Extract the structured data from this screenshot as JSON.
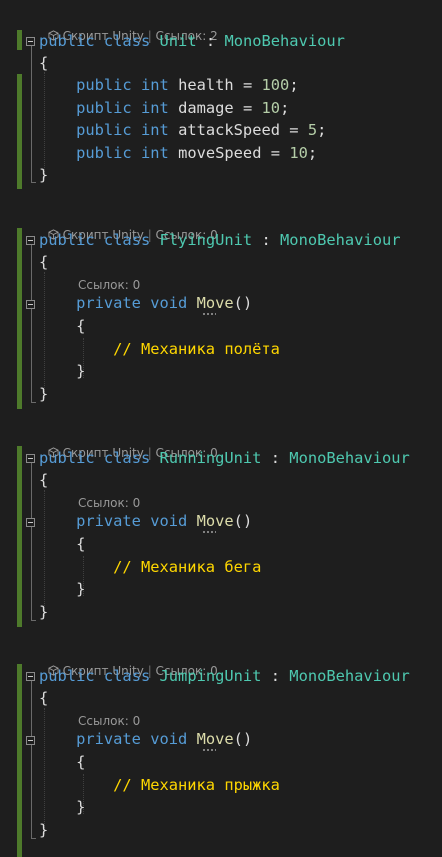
{
  "editor": {
    "classes": [
      {
        "codelens": "Скрипт Unity",
        "refs": "Ссылок: 2",
        "kw_public": "public",
        "kw_class": "class",
        "name": "Unit",
        "colon": ":",
        "base": "MonoBehaviour",
        "open_brace": "{",
        "fields": [
          {
            "mod": "public",
            "type": "int",
            "name": "health",
            "eq": "=",
            "value": "100",
            "end": ";"
          },
          {
            "mod": "public",
            "type": "int",
            "name": "damage",
            "eq": "=",
            "value": "10",
            "end": ";"
          },
          {
            "mod": "public",
            "type": "int",
            "name": "attackSpeed",
            "eq": "=",
            "value": "5",
            "end": ";"
          },
          {
            "mod": "public",
            "type": "int",
            "name": "moveSpeed",
            "eq": "=",
            "value": "10",
            "end": ";"
          }
        ],
        "close_brace": "}"
      },
      {
        "codelens": "Скрипт Unity",
        "refs": "Ссылок: 0",
        "kw_public": "public",
        "kw_class": "class",
        "name": "FlyingUnit",
        "colon": ":",
        "base": "MonoBehaviour",
        "open_brace": "{",
        "method": {
          "refs": "Ссылок: 0",
          "mod": "private",
          "ret": "void",
          "name": "Move",
          "parens": "()",
          "open": "{",
          "comment": "// Механика полёта",
          "close": "}"
        },
        "close_brace": "}"
      },
      {
        "codelens": "Скрипт Unity",
        "refs": "Ссылок: 0",
        "kw_public": "public",
        "kw_class": "class",
        "name": "RunningUnit",
        "colon": ":",
        "base": "MonoBehaviour",
        "open_brace": "{",
        "method": {
          "refs": "Ссылок: 0",
          "mod": "private",
          "ret": "void",
          "name": "Move",
          "parens": "()",
          "open": "{",
          "comment": "// Механика бега",
          "close": "}"
        },
        "close_brace": "}"
      },
      {
        "codelens": "Скрипт Unity",
        "refs": "Ссылок: 0",
        "kw_public": "public",
        "kw_class": "class",
        "name": "JumpingUnit",
        "colon": ":",
        "base": "MonoBehaviour",
        "open_brace": "{",
        "method": {
          "refs": "Ссылок: 0",
          "mod": "private",
          "ret": "void",
          "name": "Move",
          "parens": "()",
          "open": "{",
          "comment": "// Механика прыжка",
          "close": "}"
        },
        "close_brace": "}"
      }
    ],
    "colors": {
      "background": "#1e1e1e",
      "keyword": "#569cd6",
      "type": "#4ec9b0",
      "number": "#b5cea8",
      "method": "#dcdcaa",
      "comment": "#ffd700",
      "change_bar": "#4e7a2b"
    },
    "icons": {
      "codelens": "unity-cube-icon",
      "fold": "collapse-minus-icon"
    }
  }
}
